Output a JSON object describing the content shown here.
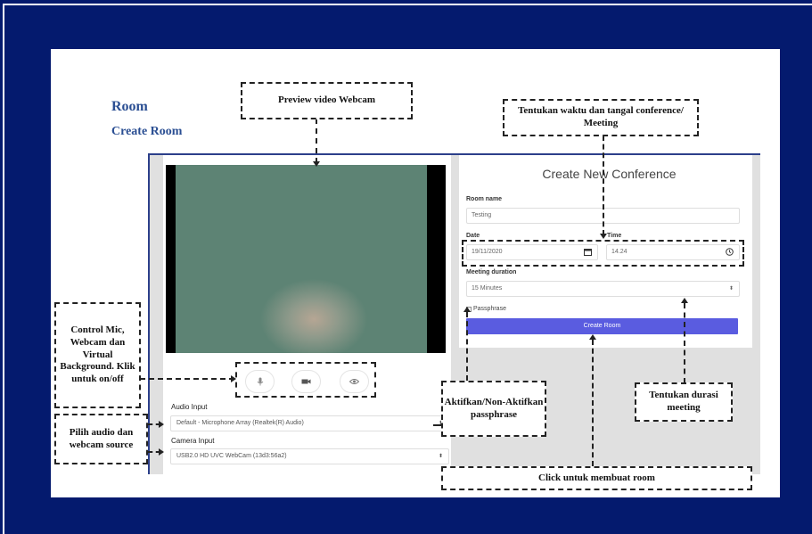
{
  "slide": {
    "heading_room": "Room",
    "heading_create_room": "Create Room"
  },
  "media_panel": {
    "controls": [
      {
        "icon": "microphone-icon"
      },
      {
        "icon": "webcam-icon"
      },
      {
        "icon": "eye-icon"
      }
    ],
    "audio_input_label": "Audio Input",
    "audio_input_value": "Default - Microphone Array (Realtek(R) Audio)",
    "camera_input_label": "Camera Input",
    "camera_input_value": "USB2.0 HD UVC WebCam (13d3:56a2)"
  },
  "conference_form": {
    "title": "Create New Conference",
    "room_name_label": "Room name",
    "room_name_value": "Testing",
    "date_label": "Date",
    "date_value": "19/11/2020",
    "time_label": "Time",
    "time_value": "14.24",
    "duration_label": "Meeting duration",
    "duration_value": "15 Minutes",
    "passphrase_label": "Passphrase",
    "create_button": "Create Room"
  },
  "annotations": {
    "preview": "Preview video Webcam",
    "datetime": "Tentukan waktu dan tangal conference/ Meeting",
    "controls": "Control Mic, Webcam dan Virtual Background. Klik untuk on/off",
    "source": "Pilih audio dan webcam source",
    "passphrase": "Aktifkan/Non-Aktifkan passphrase",
    "duration": "Tentukan durasi meeting",
    "create": "Click untuk membuat room"
  },
  "colors": {
    "background": "#041a6e",
    "heading": "#2b4f93",
    "button": "#5a5ce0"
  }
}
